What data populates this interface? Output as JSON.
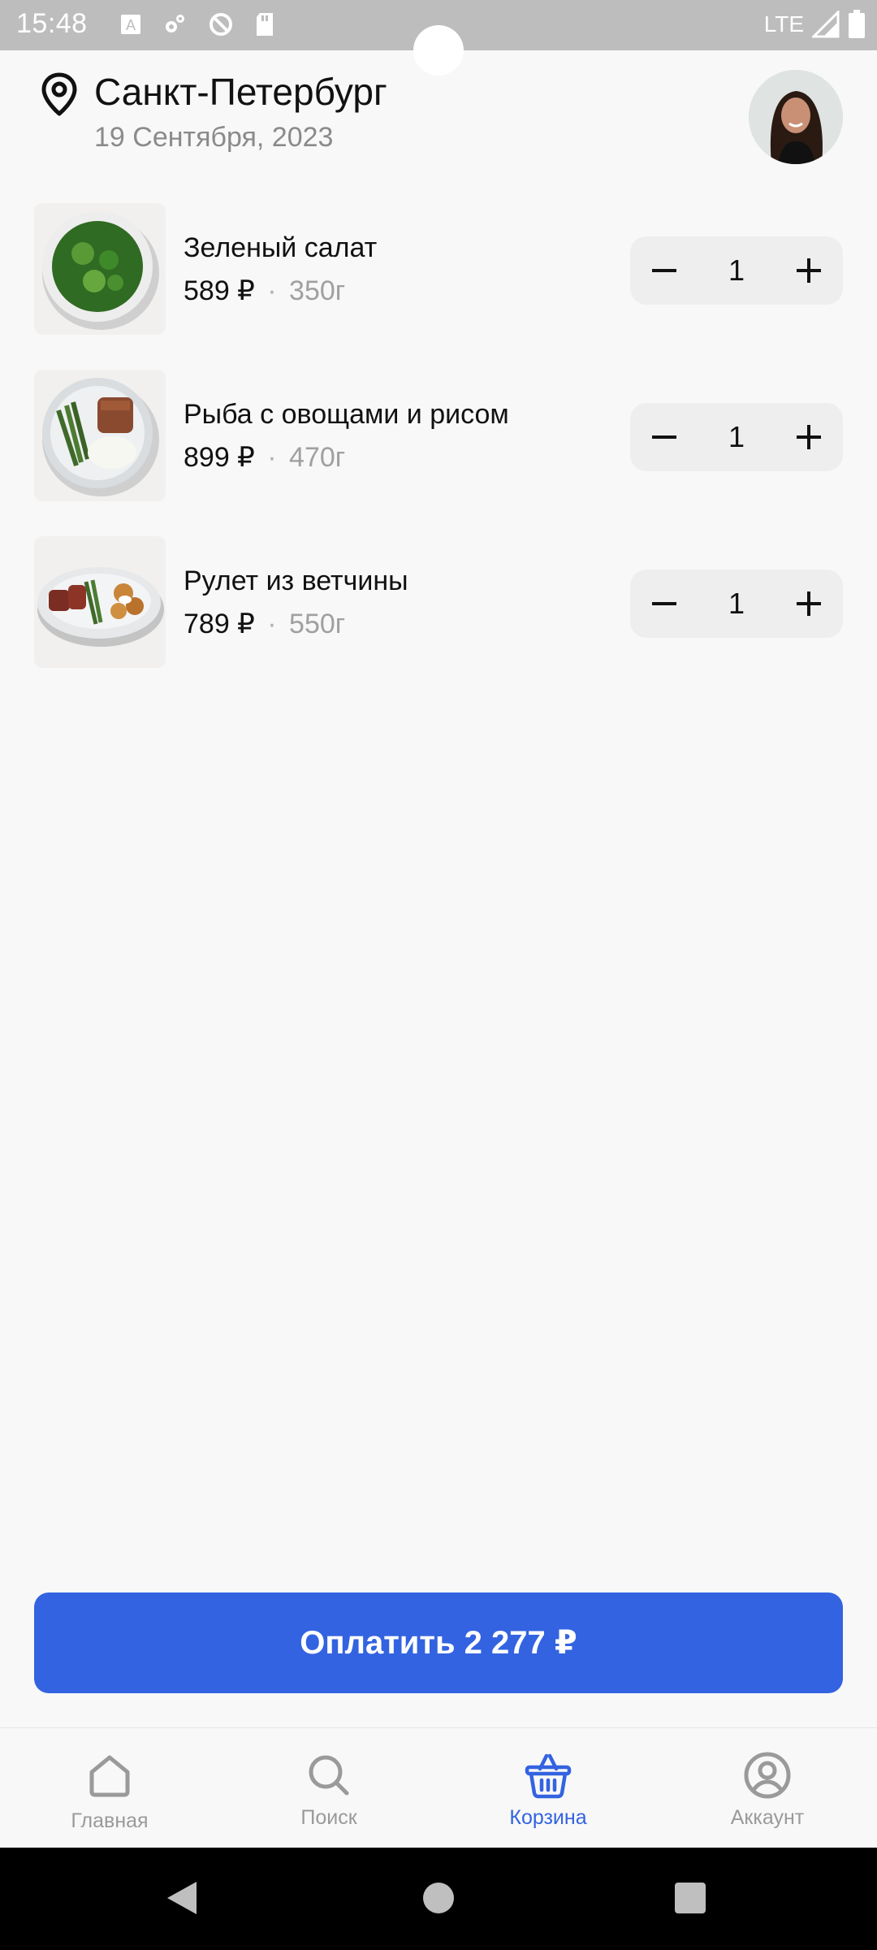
{
  "status_bar": {
    "time": "15:48",
    "network": "LTE",
    "icons_left": [
      "font-a-icon",
      "settings-icon",
      "no-sync-icon",
      "sd-card-icon"
    ],
    "icons_right": [
      "signal-icon",
      "battery-icon"
    ]
  },
  "header": {
    "city": "Санкт-Петербург",
    "date": "19 Сентября, 2023",
    "location_icon": "location-pin-icon"
  },
  "cart": {
    "items": [
      {
        "name": "Зеленый салат",
        "price": "589 ₽",
        "separator": "·",
        "weight": "350г",
        "quantity": "1"
      },
      {
        "name": "Рыба с овощами и рисом",
        "price": "899 ₽",
        "separator": "·",
        "weight": "470г",
        "quantity": "1"
      },
      {
        "name": "Рулет из ветчины",
        "price": "789 ₽",
        "separator": "·",
        "weight": "550г",
        "quantity": "1"
      }
    ]
  },
  "pay_button": {
    "label": "Оплатить 2 277 ₽"
  },
  "bottom_nav": {
    "items": [
      {
        "label": "Главная",
        "icon": "home-icon",
        "active": false
      },
      {
        "label": "Поиск",
        "icon": "search-icon",
        "active": false
      },
      {
        "label": "Корзина",
        "icon": "basket-icon",
        "active": true
      },
      {
        "label": "Аккаунт",
        "icon": "account-icon",
        "active": false
      }
    ]
  },
  "colors": {
    "accent": "#3363e0",
    "background": "#f8f8f8",
    "status_bar": "#bdbdbd",
    "muted_text": "#8a8a8a",
    "stepper_bg": "#eeeeee"
  }
}
